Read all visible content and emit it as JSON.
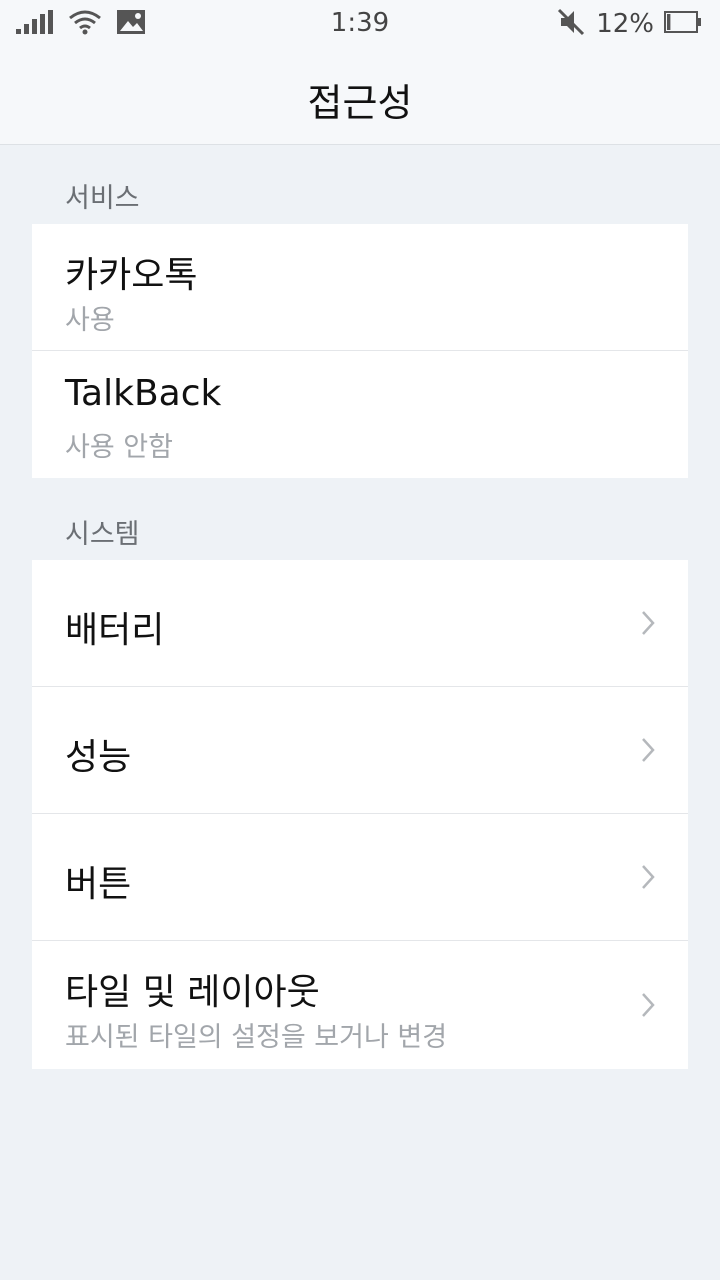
{
  "status_bar": {
    "time": "1:39",
    "battery_percent": "12%",
    "battery_level": 0.12,
    "icons": [
      "signal-icon",
      "wifi-icon",
      "image-icon",
      "mute-icon",
      "battery-icon"
    ]
  },
  "header": {
    "title": "접근성"
  },
  "sections": {
    "services": {
      "label": "서비스",
      "items": [
        {
          "title": "카카오톡",
          "subtitle": "사용"
        },
        {
          "title": "TalkBack",
          "subtitle": "사용 안함"
        }
      ]
    },
    "system": {
      "label": "시스템",
      "items": [
        {
          "title": "배터리"
        },
        {
          "title": "성능"
        },
        {
          "title": "버튼"
        },
        {
          "title": "타일 및 레이아웃",
          "subtitle": "표시된 타일의 설정을 보거나 변경"
        }
      ]
    }
  },
  "colors": {
    "background": "#eef2f6",
    "card": "#ffffff",
    "subtitle": "#a2a6ab",
    "section_label": "#6b6f74",
    "chevron": "#b5b8bc"
  }
}
